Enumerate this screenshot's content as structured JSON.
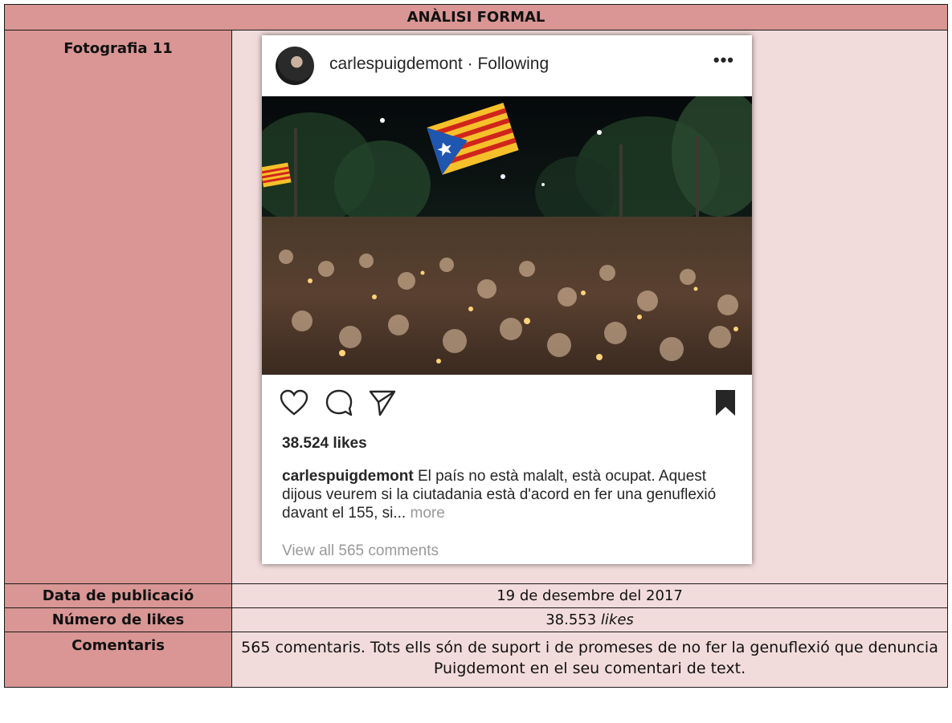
{
  "header": {
    "title": "ANÀLISI FORMAL"
  },
  "rows": {
    "photo": {
      "label": "Fotografia 11"
    },
    "date": {
      "label": "Data de publicació",
      "value": "19 de desembre del 2017"
    },
    "likes": {
      "label": "Número de likes",
      "value_number": "38.553",
      "value_unit": "likes"
    },
    "comments": {
      "label": "Comentaris",
      "value": "565 comentaris. Tots ells són de suport i de promeses de no fer la genuflexió que denuncia Puigdemont en el seu comentari de text."
    }
  },
  "post": {
    "username": "carlespuigdemont",
    "follow_status": "Following",
    "more_icon": "more-options-icon",
    "likes": "38.524 likes",
    "caption_user": "carlespuigdemont",
    "caption_text": "El país no està malalt, està ocupat. Aquest dijous veurem si la ciutadania està d'acord en fer una genuflexió davant el 155, si...",
    "caption_more": "more",
    "view_comments": "View all 565 comments",
    "icons": [
      "heart-icon",
      "comment-icon",
      "share-icon",
      "bookmark-icon"
    ]
  },
  "colors": {
    "label_bg": "#d99694",
    "value_bg": "#f2dcdb",
    "border": "#1a1a1a"
  }
}
